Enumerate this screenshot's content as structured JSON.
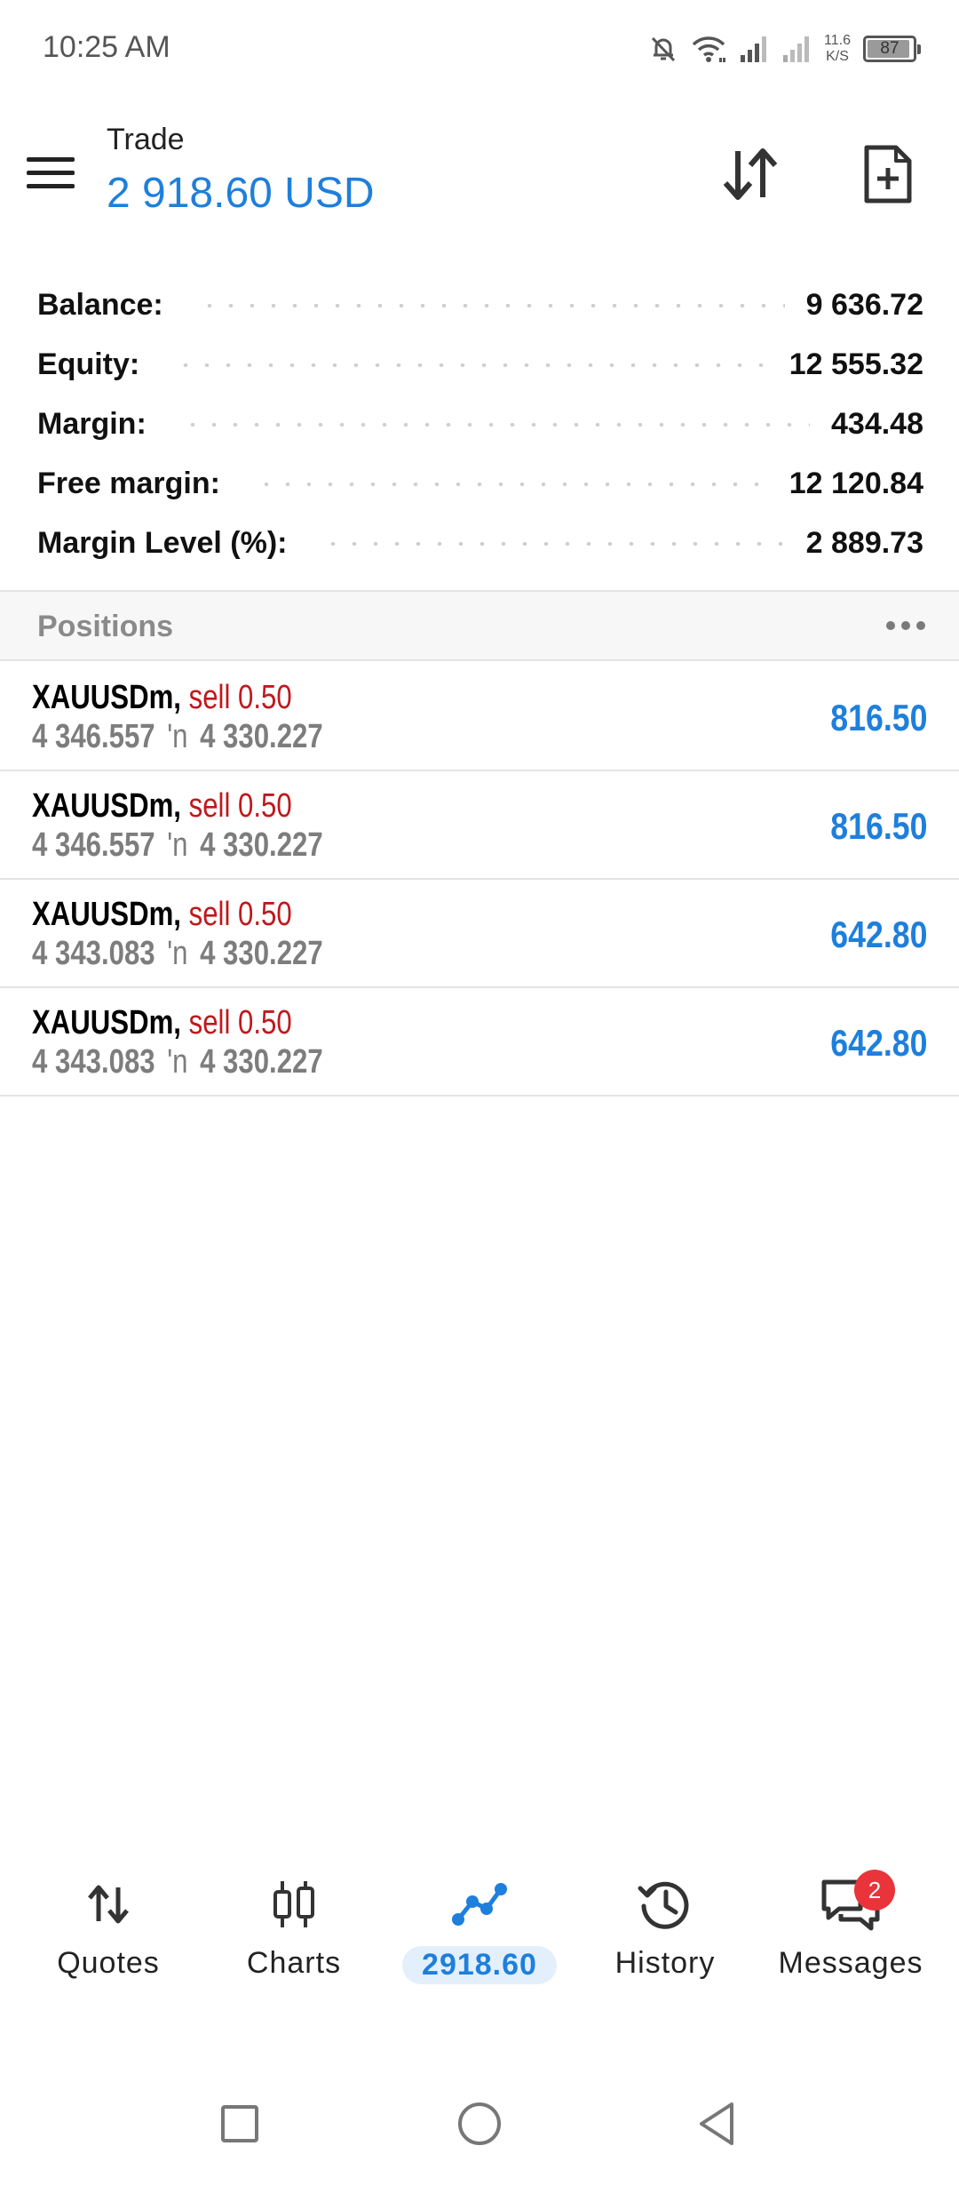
{
  "status_bar": {
    "time": "10:25 AM",
    "net_speed_value": "11.6",
    "net_speed_unit": "K/S",
    "battery_level": "87",
    "icons": [
      "mute-bell-icon",
      "wifi-icon",
      "signal-icon",
      "signal-icon"
    ]
  },
  "header": {
    "title": "Trade",
    "balance": "2 918.60 USD"
  },
  "summary": {
    "rows": [
      {
        "label": "Balance:",
        "value": "9 636.72"
      },
      {
        "label": "Equity:",
        "value": "12 555.32"
      },
      {
        "label": "Margin:",
        "value": "434.48"
      },
      {
        "label": "Free margin:",
        "value": "12 120.84"
      },
      {
        "label": "Margin Level (%):",
        "value": "2 889.73"
      }
    ]
  },
  "positions": {
    "title": "Positions",
    "items": [
      {
        "symbol": "XAUUSDm,",
        "side": "sell 0.50",
        "open_price": "4 346.557",
        "arrow": "'n",
        "current_price": "4 330.227",
        "profit": "816.50"
      },
      {
        "symbol": "XAUUSDm,",
        "side": "sell 0.50",
        "open_price": "4 346.557",
        "arrow": "'n",
        "current_price": "4 330.227",
        "profit": "816.50"
      },
      {
        "symbol": "XAUUSDm,",
        "side": "sell 0.50",
        "open_price": "4 343.083",
        "arrow": "'n",
        "current_price": "4 330.227",
        "profit": "642.80"
      },
      {
        "symbol": "XAUUSDm,",
        "side": "sell 0.50",
        "open_price": "4 343.083",
        "arrow": "'n",
        "current_price": "4 330.227",
        "profit": "642.80"
      }
    ]
  },
  "bottom_nav": {
    "quotes": "Quotes",
    "charts": "Charts",
    "trade": "2918.60",
    "history": "History",
    "messages": "Messages",
    "messages_badge": "2"
  },
  "colors": {
    "accent": "#1e7fdc",
    "sell": "#c0181c",
    "badge": "#e8343a"
  }
}
